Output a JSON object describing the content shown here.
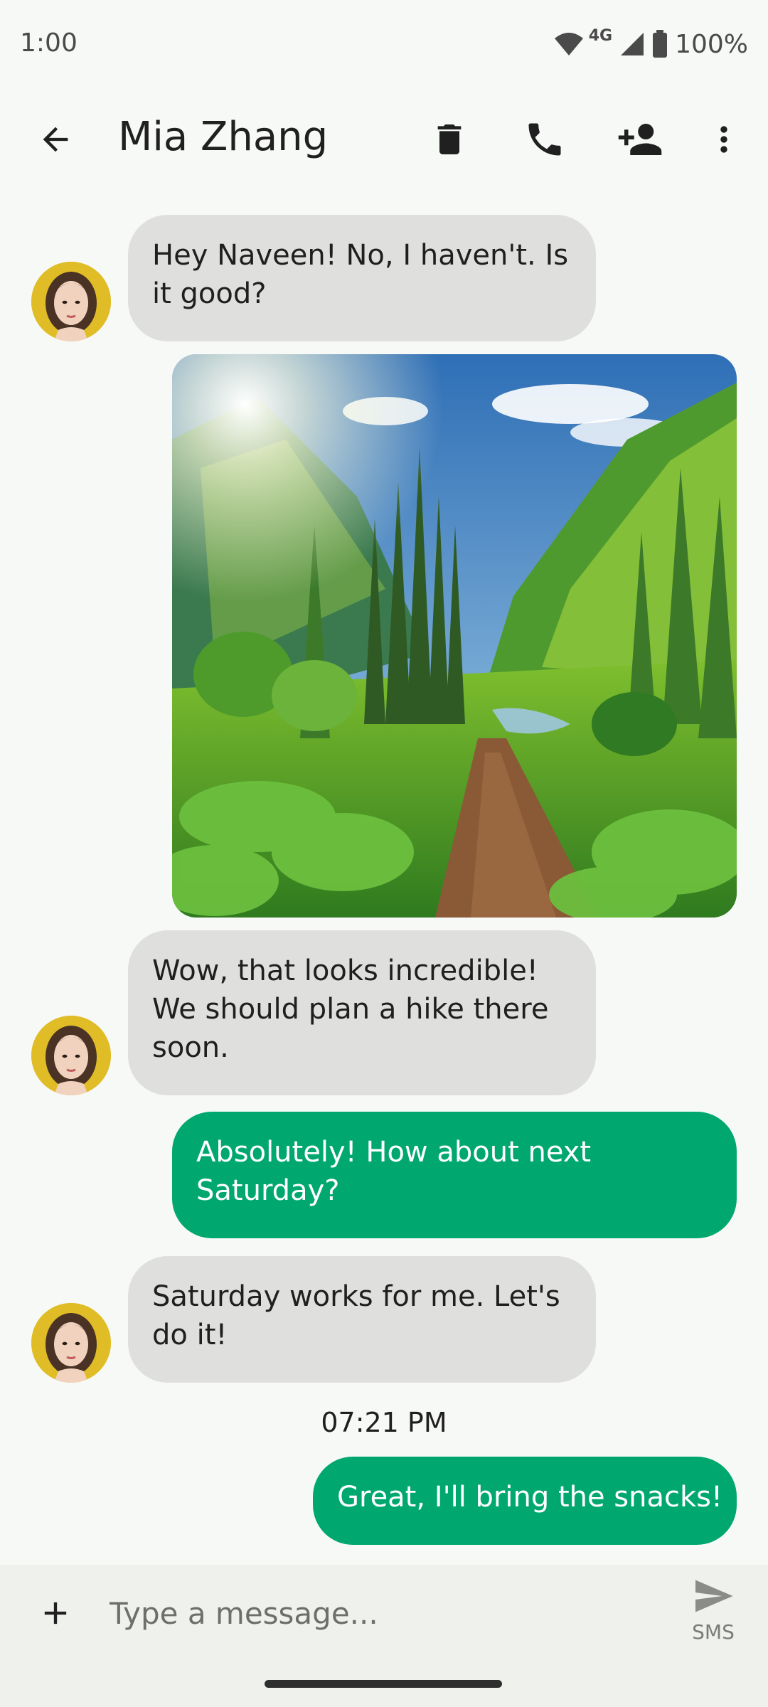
{
  "status_bar": {
    "time": "1:00",
    "network": "4G",
    "battery": "100%"
  },
  "app_bar": {
    "title": "Mia Zhang",
    "icons": [
      "back-arrow-icon",
      "delete-icon",
      "phone-icon",
      "add-contact-icon",
      "more-vert-icon"
    ]
  },
  "messages": [
    {
      "direction": "incoming",
      "text": "Hey Naveen! No, I haven't. Is\nit good?"
    },
    {
      "direction": "outgoing",
      "type": "image",
      "depicts": "forest-valley-trail"
    },
    {
      "direction": "incoming",
      "text": "Wow, that looks incredible!\nWe should plan a hike there\nsoon."
    },
    {
      "direction": "outgoing",
      "text": "Absolutely! How about next\nSaturday?"
    },
    {
      "direction": "incoming",
      "text": "Saturday works for me. Let's\ndo it!"
    },
    {
      "direction": "outgoing",
      "text": "Great, I'll bring the snacks!"
    }
  ],
  "timestamp": "07:21 PM",
  "compose": {
    "placeholder": "Type a message...",
    "send_label": "SMS"
  },
  "colors": {
    "outgoing_bubble": "#00a86f",
    "incoming_bubble": "#dfe0de",
    "background": "#f7f9f6",
    "compose_bar": "#eff1ec"
  }
}
